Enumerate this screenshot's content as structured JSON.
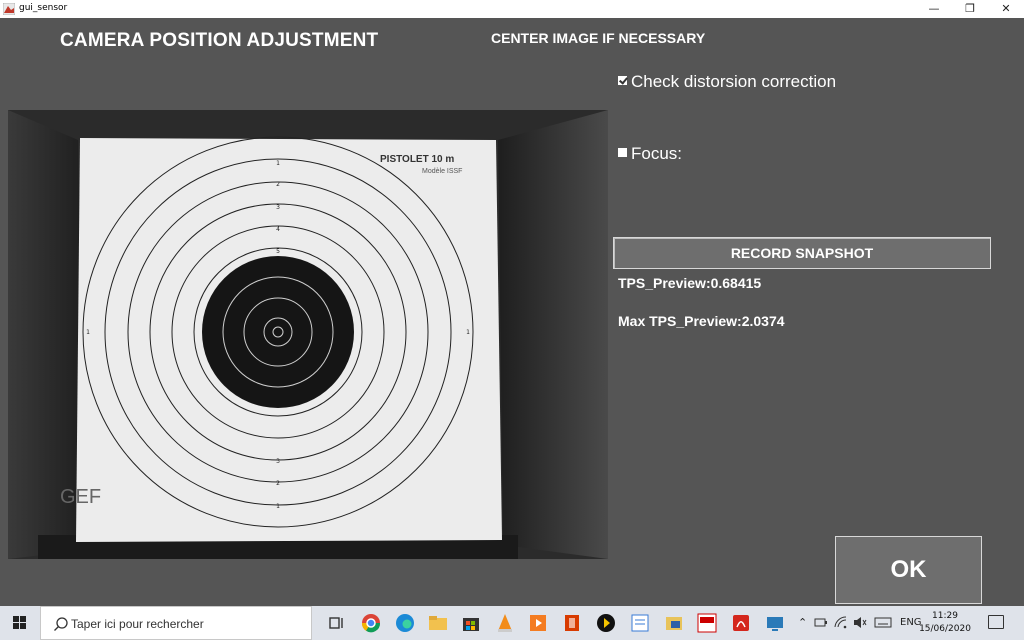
{
  "window": {
    "title": "gui_sensor",
    "min_glyph": "—",
    "max_glyph": "❐",
    "close_glyph": "✕"
  },
  "header": {
    "title": "CAMERA POSITION ADJUSTMENT",
    "hint": "CENTER IMAGE IF NECESSARY"
  },
  "options": {
    "distortion": {
      "label": "Check distorsion correction",
      "checked": true
    },
    "focus": {
      "label": "Focus:",
      "checked": false
    }
  },
  "actions": {
    "snapshot_label": "RECORD SNAPSHOT",
    "ok_label": "OK"
  },
  "stats": {
    "tps_preview": "TPS_Preview:0.68415",
    "max_tps_preview": "Max TPS_Preview:2.0374"
  },
  "camera": {
    "target_title": "PISTOLET 10 m",
    "target_subtitle": "Modèle ISSF",
    "brand": "GEF",
    "ring_numbers": [
      "1",
      "2",
      "3",
      "4",
      "5",
      "6",
      "7",
      "8"
    ]
  },
  "taskbar": {
    "search_placeholder": "Taper ici pour rechercher",
    "language": "ENG",
    "time": "11:29",
    "date": "15/06/2020",
    "icons": [
      "task-view-icon",
      "chrome-icon",
      "edge-icon",
      "file-explorer-icon",
      "store-icon",
      "vlc-icon",
      "media-icon",
      "office-icon",
      "app-icon",
      "notepad-icon",
      "folder-icon",
      "topsetups-icon",
      "acrobat-icon",
      "remote-icon",
      "photos-icon"
    ]
  },
  "colors": {
    "app_bg": "#555555",
    "button_bg": "#6e6e6e",
    "text": "#ffffff"
  }
}
